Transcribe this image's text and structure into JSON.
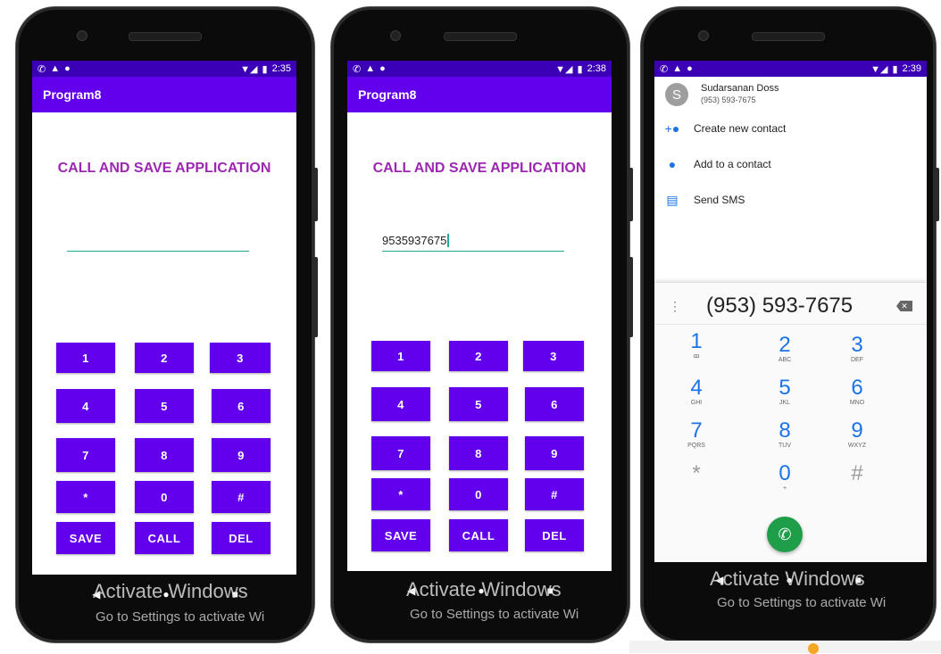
{
  "status_bar": {
    "left_icons": [
      "phone-icon",
      "warning-icon",
      "circle-icon"
    ],
    "phone1_time": "2:35",
    "phone2_time": "2:38",
    "phone3_time": "2:39"
  },
  "app": {
    "name": "Program8",
    "heading": "CALL AND SAVE APPLICATION",
    "phone1_input": "",
    "phone2_input": "9535937675",
    "keys": [
      "1",
      "2",
      "3",
      "4",
      "5",
      "6",
      "7",
      "8",
      "9",
      "*",
      "0",
      "#"
    ],
    "actions": [
      "SAVE",
      "CALL",
      "DEL"
    ],
    "accent": "#6200ee",
    "status_color": "#3b00b6",
    "heading_color": "#9c27b0"
  },
  "dialer": {
    "contact_initial": "S",
    "contact_name": "Sudarsanan Doss",
    "contact_number": "(953) 593-7675",
    "menu": [
      "Create new contact",
      "Add to a contact",
      "Send SMS"
    ],
    "entered": "(953) 593-7675",
    "keys": [
      {
        "d": "1",
        "s": "ꝏ"
      },
      {
        "d": "2",
        "s": "ABC"
      },
      {
        "d": "3",
        "s": "DEF"
      },
      {
        "d": "4",
        "s": "GHI"
      },
      {
        "d": "5",
        "s": "JKL"
      },
      {
        "d": "6",
        "s": "MNO"
      },
      {
        "d": "7",
        "s": "PQRS"
      },
      {
        "d": "8",
        "s": "TUV"
      },
      {
        "d": "9",
        "s": "WXYZ"
      },
      {
        "d": "*",
        "s": ""
      },
      {
        "d": "0",
        "s": "+"
      },
      {
        "d": "#",
        "s": ""
      }
    ],
    "call_color": "#1e9e48"
  },
  "nav": {
    "back": "◀",
    "home": "●",
    "recents": "■"
  },
  "watermark": {
    "line1": "Activate Windows",
    "line2": "Go to Settings to activate Wi"
  }
}
